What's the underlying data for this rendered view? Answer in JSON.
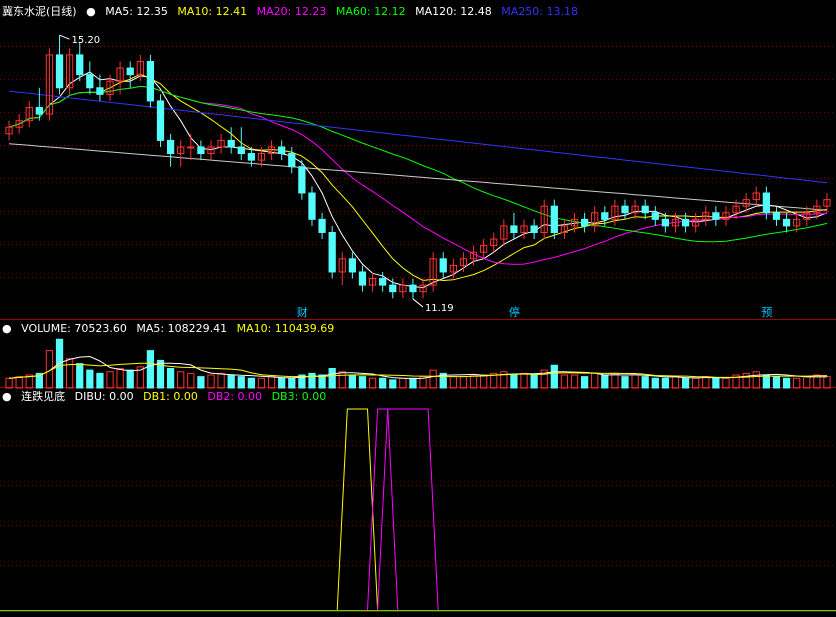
{
  "main_header": {
    "title": "冀东水泥(日线)",
    "ma": [
      {
        "label": "MA5: 12.35",
        "color": "#ffffff"
      },
      {
        "label": "MA10: 12.41",
        "color": "#ffff00"
      },
      {
        "label": "MA20: 12.23",
        "color": "#ff00ff"
      },
      {
        "label": "MA60: 12.12",
        "color": "#00ff00"
      },
      {
        "label": "MA120: 12.48",
        "color": "#ffffff"
      },
      {
        "label": "MA250: 13.18",
        "color": "#3333ff"
      }
    ]
  },
  "volume_header": {
    "title": "VOLUME: 70523.60",
    "ma5": "MA5: 108229.41",
    "ma10": "MA10: 110439.69"
  },
  "indicator_header": {
    "title": "连跌见底",
    "dibu": "DIBU: 0.00",
    "db1": "DB1: 0.00",
    "db2": "DB2: 0.00",
    "db3": "DB3: 0.00"
  },
  "colors": {
    "up": "#ff3232",
    "down": "#54fcfc",
    "grid": "#800000",
    "frame": "#a00000"
  },
  "annotations": {
    "high": "15.20",
    "low": "11.19",
    "event1": "财",
    "event2": "停",
    "event3": "预"
  },
  "chart_data": {
    "type": "candlestick",
    "price_range": [
      10.9,
      15.4
    ],
    "candles": [
      [
        13.7,
        13.9,
        13.6,
        13.8
      ],
      [
        13.8,
        14.0,
        13.7,
        13.9
      ],
      [
        13.9,
        14.2,
        13.8,
        14.1
      ],
      [
        14.1,
        14.4,
        13.9,
        14.0
      ],
      [
        14.0,
        15.0,
        13.9,
        14.9
      ],
      [
        14.9,
        15.2,
        14.3,
        14.4
      ],
      [
        14.4,
        15.0,
        14.3,
        14.9
      ],
      [
        14.9,
        15.1,
        14.5,
        14.6
      ],
      [
        14.6,
        14.8,
        14.3,
        14.4
      ],
      [
        14.4,
        14.6,
        14.2,
        14.3
      ],
      [
        14.3,
        14.6,
        14.2,
        14.5
      ],
      [
        14.5,
        14.8,
        14.3,
        14.7
      ],
      [
        14.7,
        14.8,
        14.4,
        14.6
      ],
      [
        14.6,
        14.9,
        14.5,
        14.8
      ],
      [
        14.8,
        14.9,
        14.1,
        14.2
      ],
      [
        14.2,
        14.3,
        13.5,
        13.6
      ],
      [
        13.6,
        13.7,
        13.2,
        13.4
      ],
      [
        13.4,
        13.6,
        13.2,
        13.5
      ],
      [
        13.5,
        13.7,
        13.3,
        13.5
      ],
      [
        13.5,
        13.6,
        13.3,
        13.4
      ],
      [
        13.4,
        13.6,
        13.3,
        13.5
      ],
      [
        13.5,
        13.7,
        13.4,
        13.6
      ],
      [
        13.6,
        13.8,
        13.4,
        13.5
      ],
      [
        13.5,
        13.8,
        13.3,
        13.4
      ],
      [
        13.4,
        13.5,
        13.2,
        13.3
      ],
      [
        13.3,
        13.5,
        13.2,
        13.4
      ],
      [
        13.4,
        13.6,
        13.3,
        13.5
      ],
      [
        13.5,
        13.6,
        13.3,
        13.4
      ],
      [
        13.4,
        13.5,
        13.1,
        13.2
      ],
      [
        13.2,
        13.3,
        12.7,
        12.8
      ],
      [
        12.8,
        12.9,
        12.3,
        12.4
      ],
      [
        12.4,
        12.5,
        12.1,
        12.2
      ],
      [
        12.2,
        12.3,
        11.5,
        11.6
      ],
      [
        11.6,
        11.9,
        11.4,
        11.8
      ],
      [
        11.8,
        11.9,
        11.5,
        11.6
      ],
      [
        11.6,
        11.7,
        11.3,
        11.4
      ],
      [
        11.4,
        11.6,
        11.3,
        11.5
      ],
      [
        11.5,
        11.6,
        11.3,
        11.4
      ],
      [
        11.4,
        11.5,
        11.2,
        11.3
      ],
      [
        11.3,
        11.5,
        11.2,
        11.4
      ],
      [
        11.4,
        11.5,
        11.19,
        11.3
      ],
      [
        11.3,
        11.5,
        11.2,
        11.4
      ],
      [
        11.4,
        11.9,
        11.3,
        11.8
      ],
      [
        11.8,
        11.9,
        11.5,
        11.6
      ],
      [
        11.6,
        11.8,
        11.5,
        11.7
      ],
      [
        11.7,
        11.9,
        11.6,
        11.8
      ],
      [
        11.8,
        12.0,
        11.7,
        11.9
      ],
      [
        11.9,
        12.1,
        11.8,
        12.0
      ],
      [
        12.0,
        12.2,
        11.9,
        12.1
      ],
      [
        12.1,
        12.4,
        12.0,
        12.3
      ],
      [
        12.3,
        12.5,
        12.1,
        12.2
      ],
      [
        12.2,
        12.4,
        12.1,
        12.3
      ],
      [
        12.3,
        12.4,
        12.1,
        12.2
      ],
      [
        12.2,
        12.7,
        12.1,
        12.6
      ],
      [
        12.6,
        12.7,
        12.1,
        12.2
      ],
      [
        12.2,
        12.4,
        12.1,
        12.3
      ],
      [
        12.3,
        12.5,
        12.2,
        12.4
      ],
      [
        12.4,
        12.5,
        12.2,
        12.3
      ],
      [
        12.3,
        12.6,
        12.2,
        12.5
      ],
      [
        12.5,
        12.6,
        12.3,
        12.4
      ],
      [
        12.4,
        12.7,
        12.3,
        12.6
      ],
      [
        12.6,
        12.7,
        12.4,
        12.5
      ],
      [
        12.5,
        12.7,
        12.4,
        12.6
      ],
      [
        12.6,
        12.7,
        12.4,
        12.5
      ],
      [
        12.5,
        12.6,
        12.3,
        12.4
      ],
      [
        12.4,
        12.5,
        12.2,
        12.3
      ],
      [
        12.3,
        12.5,
        12.2,
        12.4
      ],
      [
        12.4,
        12.5,
        12.2,
        12.3
      ],
      [
        12.3,
        12.5,
        12.2,
        12.4
      ],
      [
        12.4,
        12.6,
        12.3,
        12.5
      ],
      [
        12.5,
        12.6,
        12.3,
        12.4
      ],
      [
        12.4,
        12.6,
        12.3,
        12.5
      ],
      [
        12.5,
        12.7,
        12.4,
        12.6
      ],
      [
        12.6,
        12.8,
        12.5,
        12.7
      ],
      [
        12.7,
        12.9,
        12.6,
        12.8
      ],
      [
        12.8,
        12.9,
        12.4,
        12.5
      ],
      [
        12.5,
        12.6,
        12.3,
        12.4
      ],
      [
        12.4,
        12.5,
        12.2,
        12.3
      ],
      [
        12.3,
        12.5,
        12.2,
        12.4
      ],
      [
        12.4,
        12.6,
        12.3,
        12.5
      ],
      [
        12.5,
        12.7,
        12.4,
        12.6
      ],
      [
        12.6,
        12.8,
        12.5,
        12.7
      ]
    ],
    "volume_range": [
      0,
      320000
    ],
    "volume": [
      60000,
      70000,
      80000,
      90000,
      230000,
      300000,
      180000,
      150000,
      110000,
      90000,
      100000,
      120000,
      110000,
      130000,
      230000,
      170000,
      120000,
      100000,
      90000,
      70000,
      80000,
      90000,
      80000,
      70000,
      60000,
      60000,
      70000,
      60000,
      60000,
      80000,
      90000,
      80000,
      120000,
      100000,
      80000,
      70000,
      60000,
      60000,
      50000,
      60000,
      60000,
      70000,
      110000,
      90000,
      70000,
      70000,
      80000,
      80000,
      90000,
      100000,
      80000,
      90000,
      80000,
      110000,
      140000,
      80000,
      80000,
      70000,
      90000,
      80000,
      90000,
      70000,
      80000,
      70000,
      60000,
      60000,
      70000,
      60000,
      60000,
      70000,
      60000,
      60000,
      80000,
      90000,
      100000,
      80000,
      70000,
      60000,
      60000,
      70000,
      80000,
      70523.6
    ],
    "dibu_pulses": [
      {
        "series": "DB1",
        "start": 34,
        "end": 36
      },
      {
        "series": "DB2",
        "start": 37,
        "end": 38
      },
      {
        "series": "DB3",
        "start": 38,
        "end": 42
      }
    ]
  }
}
